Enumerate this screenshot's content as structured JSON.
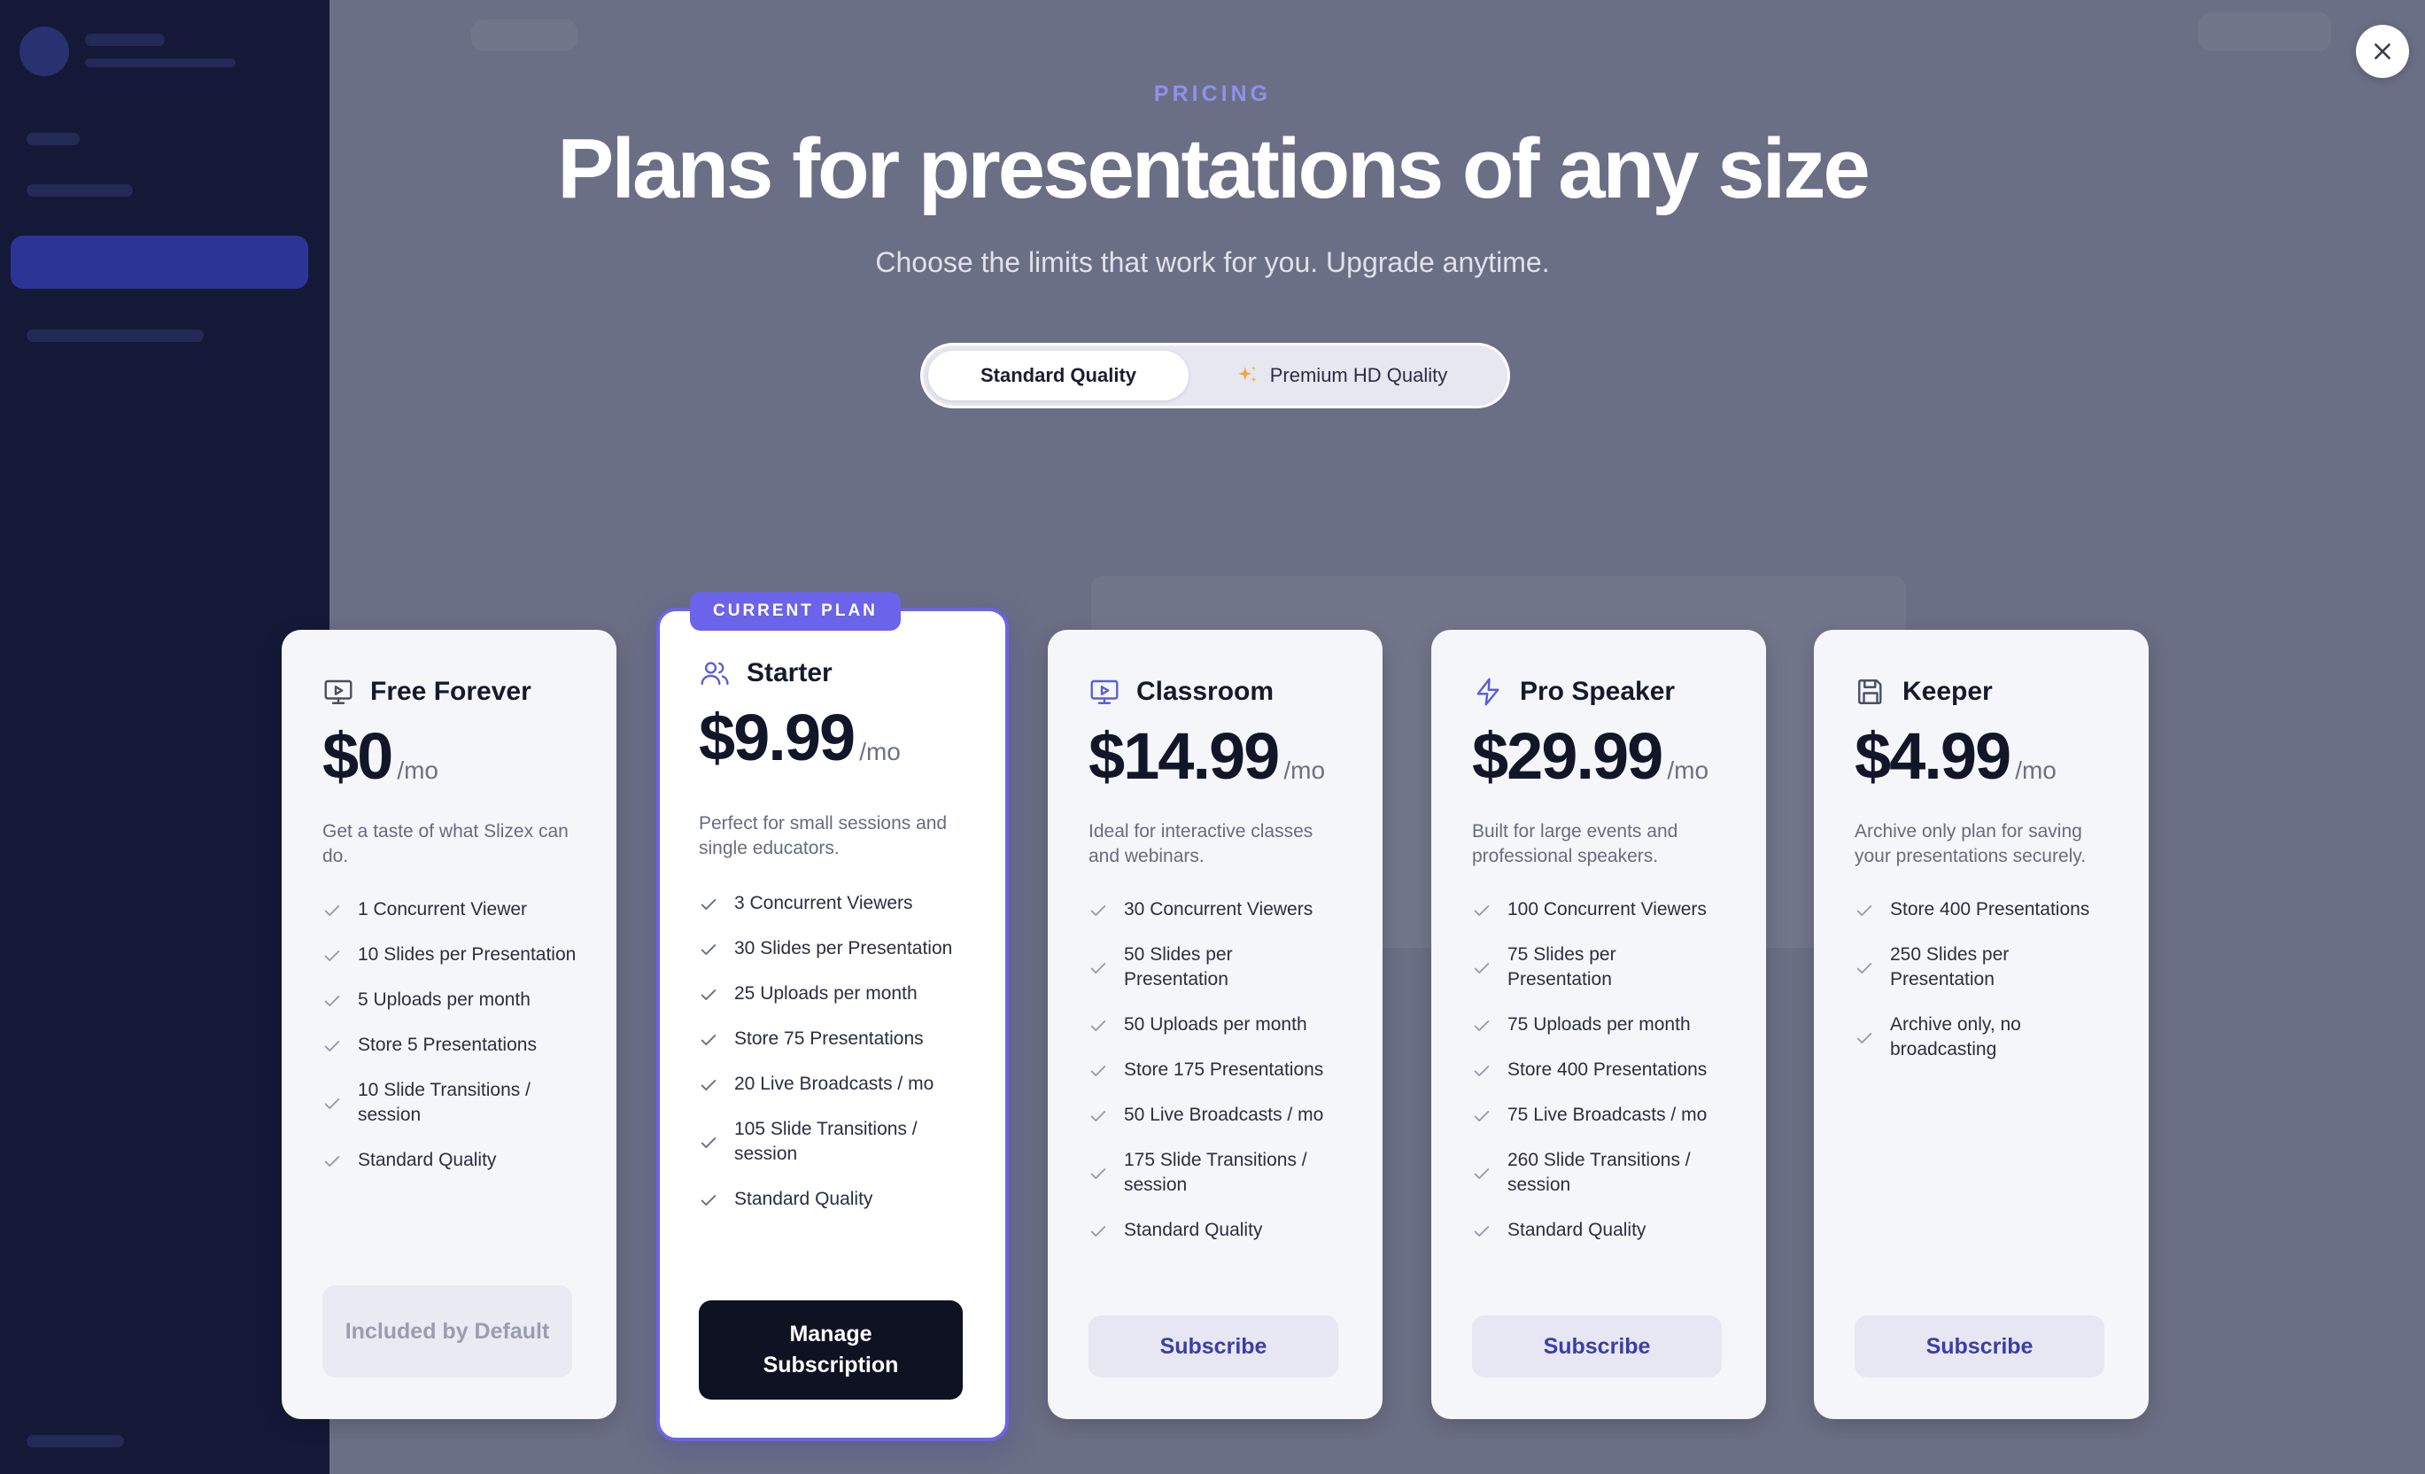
{
  "modal": {
    "eyebrow": "PRICING",
    "headline": "Plans for presentations of any size",
    "subheadline": "Choose the limits that work for you. Upgrade anytime.",
    "quality_toggle": {
      "options": [
        "Standard Quality",
        "Premium HD Quality"
      ],
      "selected": "Standard Quality"
    },
    "close_icon": "close-icon"
  },
  "plans": [
    {
      "name": "Free Forever",
      "icon": "presentation-icon",
      "price": "$0",
      "period": "/mo",
      "description": "Get a taste of what Slizex can do.",
      "features": [
        "1 Concurrent Viewer",
        "10 Slides per Presentation",
        "5 Uploads per month",
        "Store 5 Presentations",
        "10 Slide Transitions / session",
        "Standard Quality"
      ],
      "button": "Included by Default",
      "current": false
    },
    {
      "name": "Starter",
      "icon": "users-icon",
      "price": "$9.99",
      "period": "/mo",
      "description": "Perfect for small sessions and single educators.",
      "features": [
        "3 Concurrent Viewers",
        "30 Slides per Presentation",
        "25 Uploads per month",
        "Store 75 Presentations",
        "20 Live Broadcasts / mo",
        "105 Slide Transitions / session",
        "Standard Quality"
      ],
      "button": "Manage Subscription",
      "current": true,
      "badge": "CURRENT PLAN"
    },
    {
      "name": "Classroom",
      "icon": "presentation-icon",
      "price": "$14.99",
      "period": "/mo",
      "description": "Ideal for interactive classes and webinars.",
      "features": [
        "30 Concurrent Viewers",
        "50 Slides per Presentation",
        "50 Uploads per month",
        "Store 175 Presentations",
        "50 Live Broadcasts / mo",
        "175 Slide Transitions / session",
        "Standard Quality"
      ],
      "button": "Subscribe",
      "current": false
    },
    {
      "name": "Pro Speaker",
      "icon": "lightning-icon",
      "price": "$29.99",
      "period": "/mo",
      "description": "Built for large events and professional speakers.",
      "features": [
        "100 Concurrent Viewers",
        "75 Slides per Presentation",
        "75 Uploads per month",
        "Store 400 Presentations",
        "75 Live Broadcasts / mo",
        "260 Slide Transitions / session",
        "Standard Quality"
      ],
      "button": "Subscribe",
      "current": false
    },
    {
      "name": "Keeper",
      "icon": "save-icon",
      "price": "$4.99",
      "period": "/mo",
      "description": "Archive only plan for saving your presentations securely.",
      "features": [
        "Store 400 Presentations",
        "250 Slides per Presentation",
        "Archive only, no broadcasting"
      ],
      "button": "Subscribe",
      "current": false
    }
  ],
  "colors": {
    "accent": "#6b63ea",
    "eyebrow": "#8f90ee",
    "overlay": "#6b6f85",
    "sidebar": "#141938",
    "dark_button": "#0e1222",
    "subscribe_text": "#3b3ea8"
  }
}
